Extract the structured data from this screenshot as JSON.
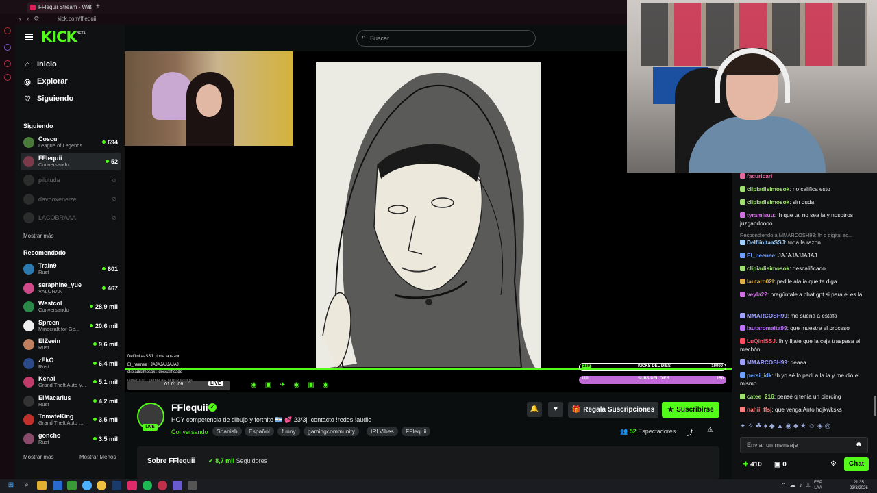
{
  "browser": {
    "tab_title": "FFlequii Stream - Watch Li",
    "url": "kick.com/fflequii"
  },
  "brand": {
    "logo": "KICK",
    "beta": "BETA",
    "accent": "#53fc18"
  },
  "search": {
    "placeholder": "Buscar"
  },
  "nav": {
    "inicio": "Inicio",
    "explorar": "Explorar",
    "siguiendo": "Siguiendo"
  },
  "following": {
    "title": "Siguiendo",
    "items": [
      {
        "name": "Coscu",
        "category": "League of Legends",
        "viewers": "694",
        "color": "#4a7b3a"
      },
      {
        "name": "FFlequii",
        "category": "Conversando",
        "viewers": "52",
        "color": "#7a3a4a"
      },
      {
        "name": "pilutuda",
        "category": "",
        "viewers": "",
        "color": "#555"
      },
      {
        "name": "davooxeneize",
        "category": "",
        "viewers": "",
        "color": "#555"
      },
      {
        "name": "LACOBRAAA",
        "category": "",
        "viewers": "",
        "color": "#555"
      }
    ],
    "show_more": "Mostrar más"
  },
  "recommended": {
    "title": "Recomendado",
    "items": [
      {
        "name": "Train9",
        "category": "Rust",
        "viewers": "601",
        "color": "#2a7ab0"
      },
      {
        "name": "seraphine_yue",
        "category": "VALORANT",
        "viewers": "467",
        "color": "#d04a8a"
      },
      {
        "name": "Westcol",
        "category": "Conversando",
        "viewers": "28,9 mil",
        "color": "#2a8a4a"
      },
      {
        "name": "Spreen",
        "category": "Minecraft for Ge...",
        "viewers": "20,6 mil",
        "color": "#eeeeee"
      },
      {
        "name": "ElZeein",
        "category": "Rust",
        "viewers": "9,6 mil",
        "color": "#c08060"
      },
      {
        "name": "zEkO",
        "category": "Rust",
        "viewers": "6,4 mil",
        "color": "#2a4a8a"
      },
      {
        "name": "Kenai",
        "category": "Grand Theft Auto V...",
        "viewers": "5,1 mil",
        "color": "#c03a6a"
      },
      {
        "name": "ElMacarius",
        "category": "Rust",
        "viewers": "4,2 mil",
        "color": "#333333"
      },
      {
        "name": "TomateKing",
        "category": "Grand Theft Auto ...",
        "viewers": "3,5 mil",
        "color": "#c0302a"
      },
      {
        "name": "goncho",
        "category": "Rust",
        "viewers": "3,5 mil",
        "color": "#8a4a6a"
      }
    ],
    "show_more": "Mostrar más",
    "show_less": "Mostrar Menos"
  },
  "overlay": {
    "chat_lines": [
      "DelfiinitaaSSJ : toda la razon",
      "El_neenee : JAJAJAJJAJAJ",
      "clipiadisimosok : descalificado",
      "lautaro02l : pedile ala ia que te diga"
    ],
    "live_label": "LIVE",
    "timer": "01:01:06",
    "subs_label": "SUBS DEL DIES",
    "kicks_label": "KICKS DEL DIES",
    "kicks_left": "230",
    "kicks_right": "10000",
    "subs_left": "110",
    "subs_right": "150"
  },
  "channel": {
    "name": "FFlequii",
    "live": "LIVE",
    "title": "HOY competencia de dibujo y fortnite 🇦🇷 💕 23/3| !contacto !redes !audio",
    "category": "Conversando",
    "tags": [
      "Spanish",
      "Español",
      "funny",
      "gamingcommunity",
      "IRLVibes",
      "FFlequii"
    ],
    "gift_label": "Regala Suscripciones",
    "subscribe_label": "Suscribirse",
    "viewers_count": "52",
    "viewers_label": "Espectadores",
    "about_title": "Sobre FFlequii",
    "followers_count": "8,7 mil",
    "followers_label": "Seguidores"
  },
  "chat": {
    "messages": [
      {
        "user": "facuricari",
        "text": "",
        "color": "#e06aa0"
      },
      {
        "user": "clipiadisimosok",
        "text": ": no califica esto",
        "color": "#a0e070"
      },
      {
        "user": "clipiadisimosok",
        "text": ": sin duda",
        "color": "#a0e070"
      },
      {
        "user": "tyramisuu",
        "text": ": !h que tal no sea ia y nosotros juzgandoooo",
        "color": "#d070e0"
      },
      {
        "user": "DelfiinitaaSSJ",
        "text": ": toda la razon",
        "color": "#a0d0ff"
      },
      {
        "user": "El_neenee",
        "text": ": JAJAJAJJAJAJ",
        "color": "#70a0ff"
      },
      {
        "user": "clipiadisimosok",
        "text": ": descalificado",
        "color": "#a0e070"
      },
      {
        "user": "lautaro02l",
        "text": ": pedile ala ia que te diga",
        "color": "#e0b040"
      },
      {
        "user": "veyla22",
        "text": ": pregúntale a chat gpt si para el es la",
        "color": "#d070e0"
      },
      {
        "user": "MMARCOSH99",
        "text": ": me suena a estafa",
        "color": "#a0a0ff"
      },
      {
        "user": "lautaromaita99",
        "text": ": que muestre el proceso",
        "color": "#c070ff"
      },
      {
        "user": "LuQiniSSJ",
        "text": ": !h y fijate que la ceja traspasa el mechón",
        "color": "#ff5060"
      },
      {
        "user": "MMARCOSH99",
        "text": ": deaaa",
        "color": "#a0a0ff"
      },
      {
        "user": "persi_idk",
        "text": ": !h yo sé lo pedí a la ia y me dió el mismo",
        "color": "#70a0ff"
      },
      {
        "user": "catee_216",
        "text": ": pensé q tenía un piercing",
        "color": "#a0e070"
      },
      {
        "user": "nahii_ffsj",
        "text": ": que venga Anto hqjkwksks",
        "color": "#ff8080"
      }
    ],
    "reply_note": "Respondiendo a MMARCOSH99: !h q digital ac...",
    "input_placeholder": "Enviar un mensaje",
    "points": "410",
    "gifts": "0",
    "send_label": "Chat"
  },
  "taskbar": {
    "lang": "ESP",
    "layout": "LAA",
    "time": "21:35",
    "date": "23/3/2026"
  }
}
